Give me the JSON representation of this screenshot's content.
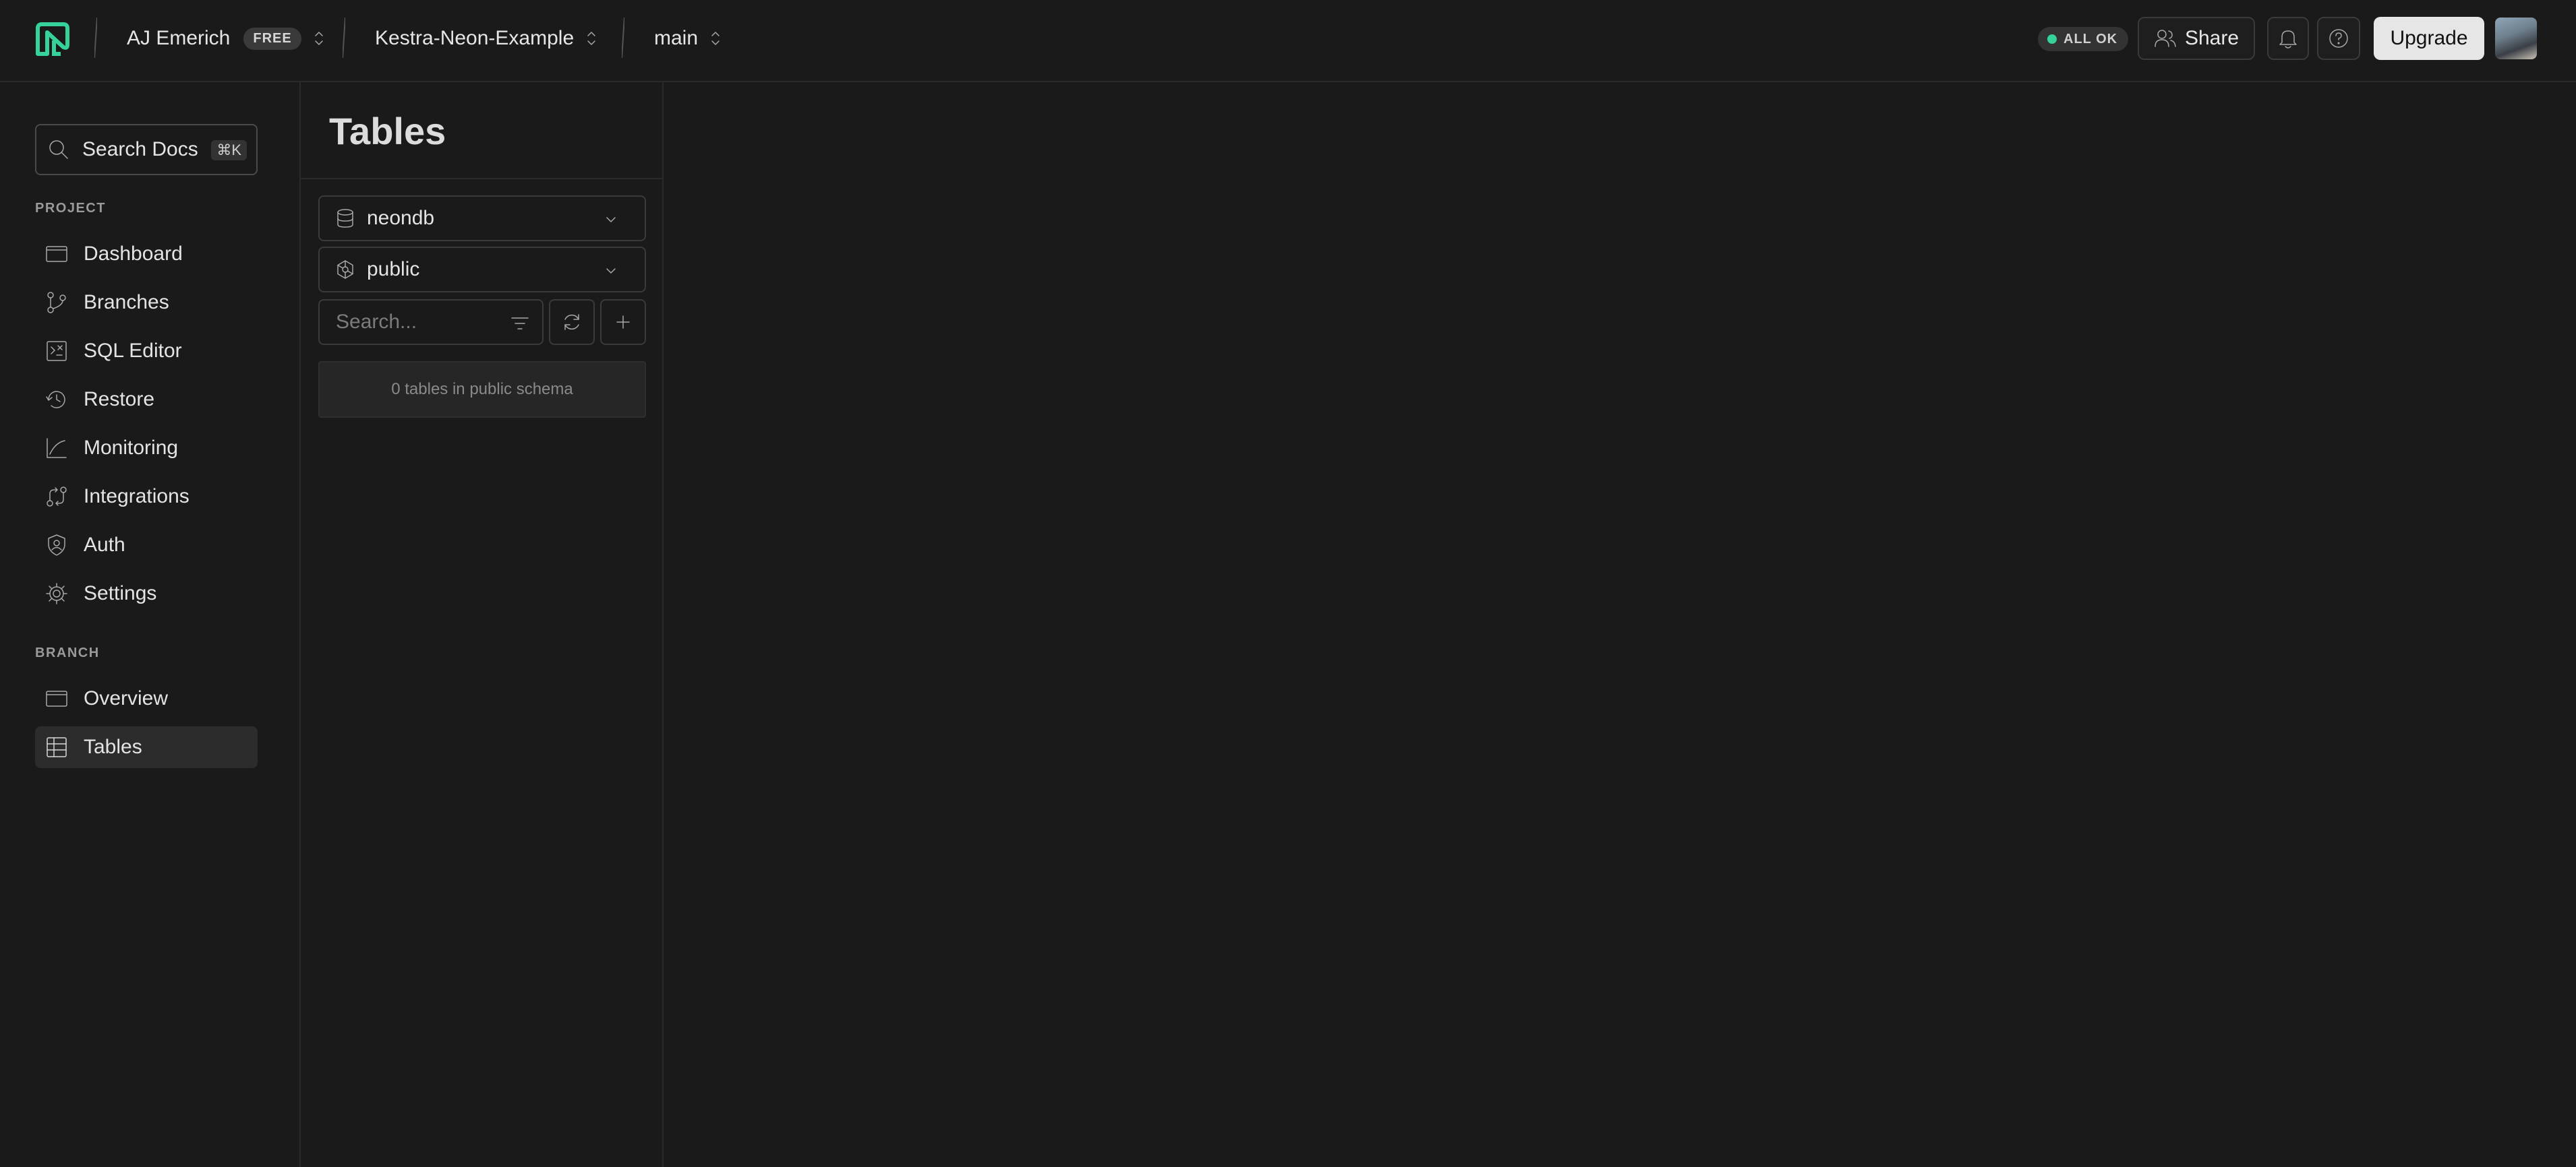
{
  "topbar": {
    "user_name": "AJ Emerich",
    "plan_badge": "FREE",
    "project_name": "Kestra-Neon-Example",
    "branch_name": "main",
    "status": "ALL OK",
    "share_label": "Share",
    "upgrade_label": "Upgrade",
    "status_color": "#35d399",
    "brand_color": "#35d399"
  },
  "sidebar": {
    "search_label": "Search Docs",
    "search_shortcut": "⌘K",
    "project_section": "PROJECT",
    "project_items": [
      {
        "label": "Dashboard",
        "icon": "dashboard-icon"
      },
      {
        "label": "Branches",
        "icon": "branches-icon"
      },
      {
        "label": "SQL Editor",
        "icon": "sql-editor-icon"
      },
      {
        "label": "Restore",
        "icon": "restore-icon"
      },
      {
        "label": "Monitoring",
        "icon": "monitoring-icon"
      },
      {
        "label": "Integrations",
        "icon": "integrations-icon"
      },
      {
        "label": "Auth",
        "icon": "auth-icon"
      },
      {
        "label": "Settings",
        "icon": "gear-icon"
      }
    ],
    "branch_section": "BRANCH",
    "branch_items": [
      {
        "label": "Overview",
        "icon": "overview-icon"
      },
      {
        "label": "Tables",
        "icon": "tables-icon",
        "active": true
      }
    ]
  },
  "tables_panel": {
    "title": "Tables",
    "database": "neondb",
    "schema": "public",
    "search_placeholder": "Search...",
    "empty_message": "0 tables in public schema"
  }
}
